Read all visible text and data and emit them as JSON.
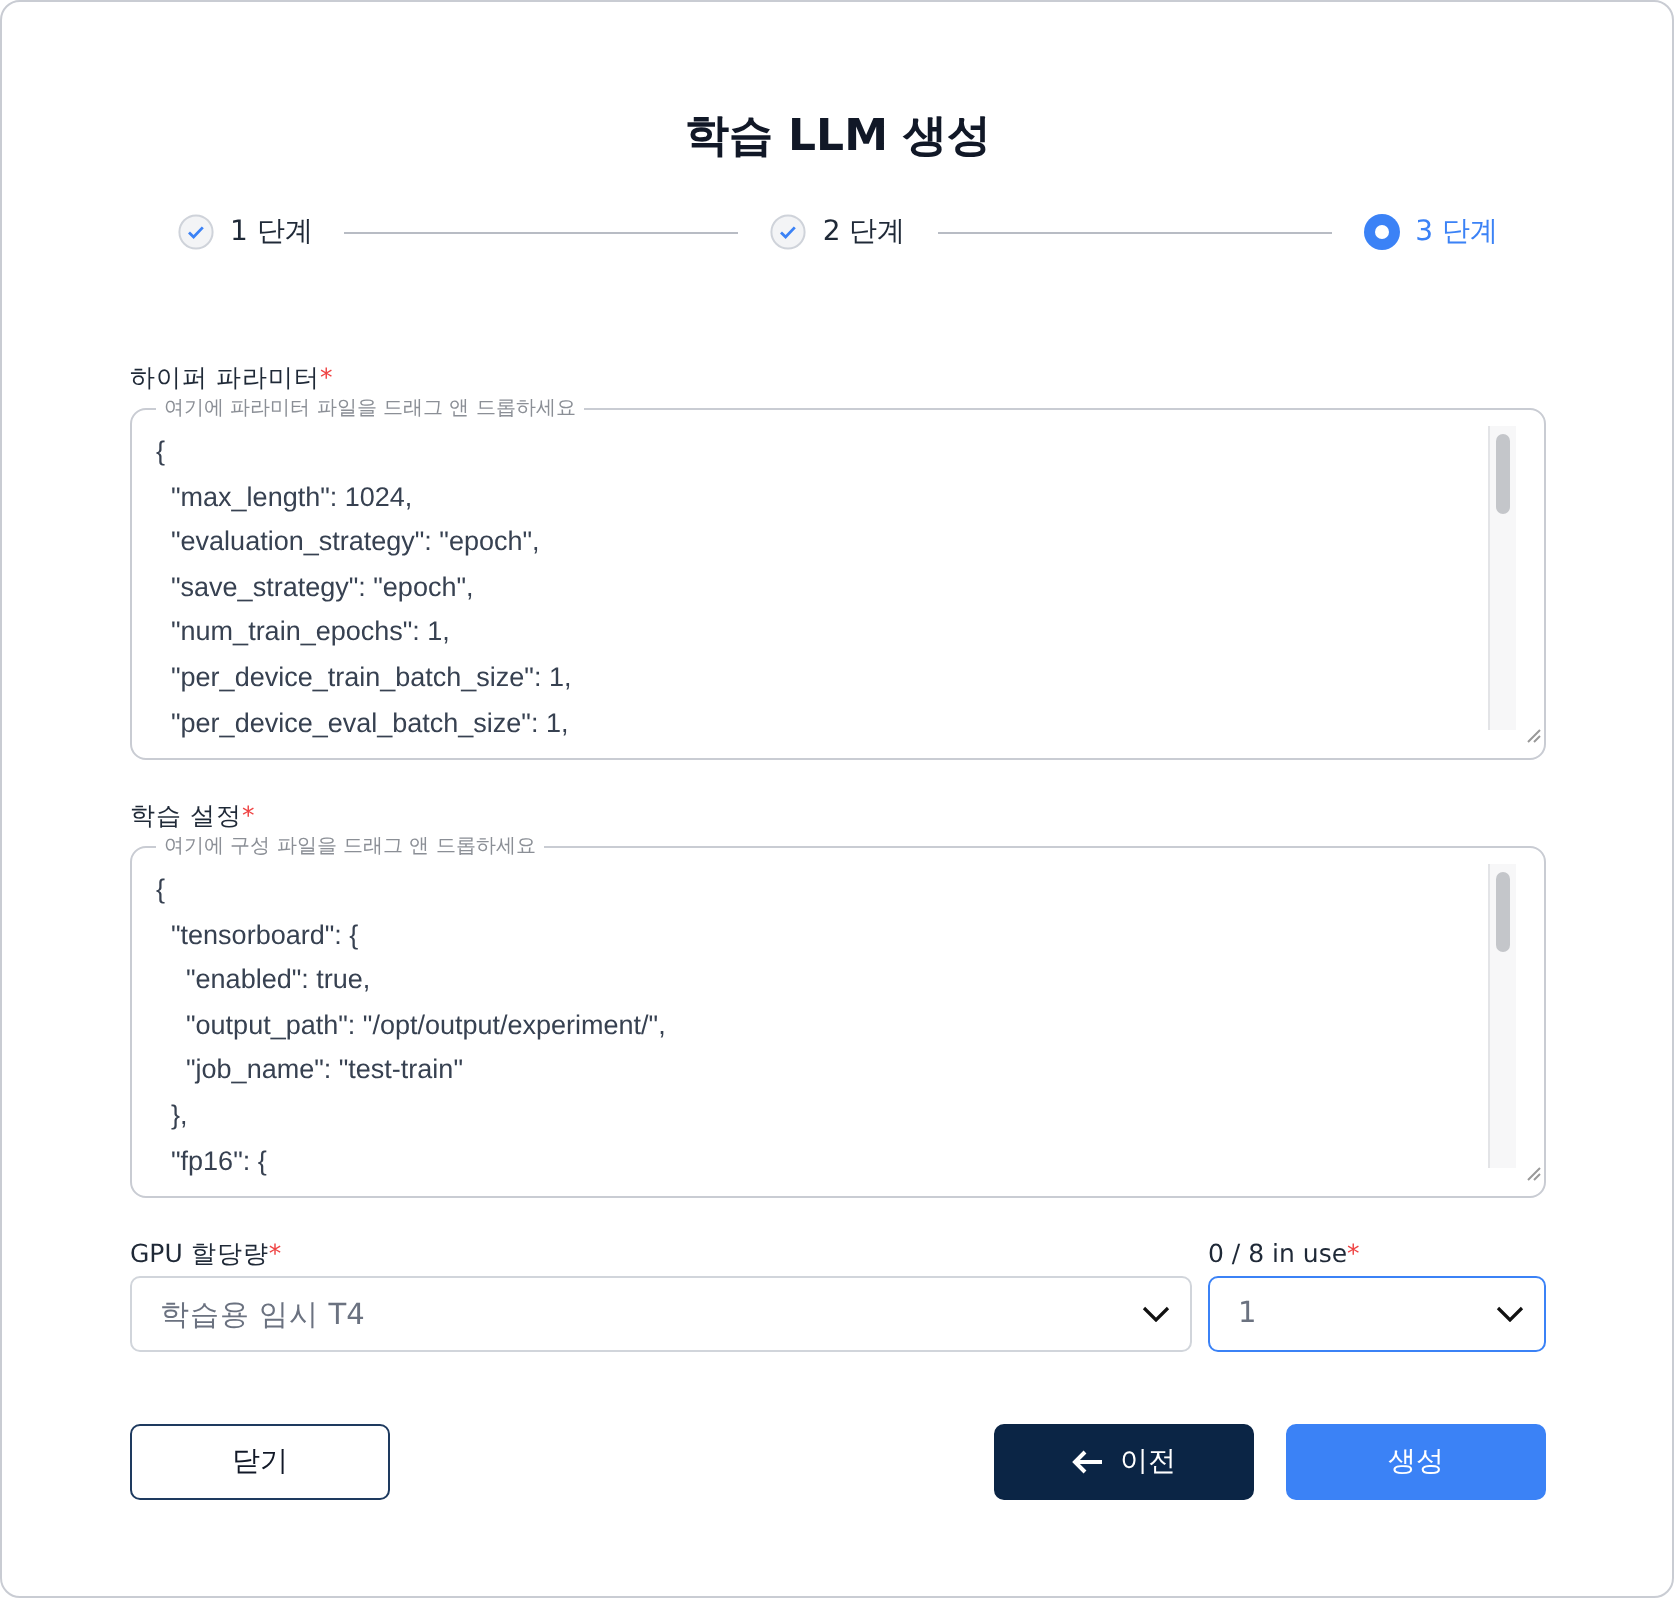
{
  "title": "학습 LLM 생성",
  "steps": [
    {
      "label": "1 단계",
      "selected": false
    },
    {
      "label": "2 단계",
      "selected": false
    },
    {
      "label": "3 단계",
      "selected": true
    }
  ],
  "editors": [
    {
      "label": "하이퍼 파라미터",
      "required_mark": "*",
      "drop_hint": "여기에 파라미터 파일을 드래그 앤 드롭하세요",
      "value": "{\n  \"max_length\": 1024,\n  \"evaluation_strategy\": \"epoch\",\n  \"save_strategy\": \"epoch\",\n  \"num_train_epochs\": 1,\n  \"per_device_train_batch_size\": 1,\n  \"per_device_eval_batch_size\": 1,"
    },
    {
      "label": "학습 설정",
      "required_mark": "*",
      "drop_hint": "여기에 구성 파일을 드래그 앤 드롭하세요",
      "value": "{\n  \"tensorboard\": {\n    \"enabled\": true,\n    \"output_path\": \"/opt/output/experiment/\",\n    \"job_name\": \"test-train\"\n  },\n  \"fp16\": {"
    }
  ],
  "selects": [
    {
      "label": "GPU 할당량",
      "required_mark": "*",
      "value": "학습용 임시 T4",
      "focused": false
    },
    {
      "label": "0 / 8 in use",
      "required_mark": "*",
      "value": "1",
      "focused": true
    }
  ],
  "buttons": [
    {
      "label": "닫기",
      "kind": "outline"
    },
    {
      "label": "이전",
      "kind": "back"
    },
    {
      "label": "생성",
      "kind": "primary"
    }
  ]
}
